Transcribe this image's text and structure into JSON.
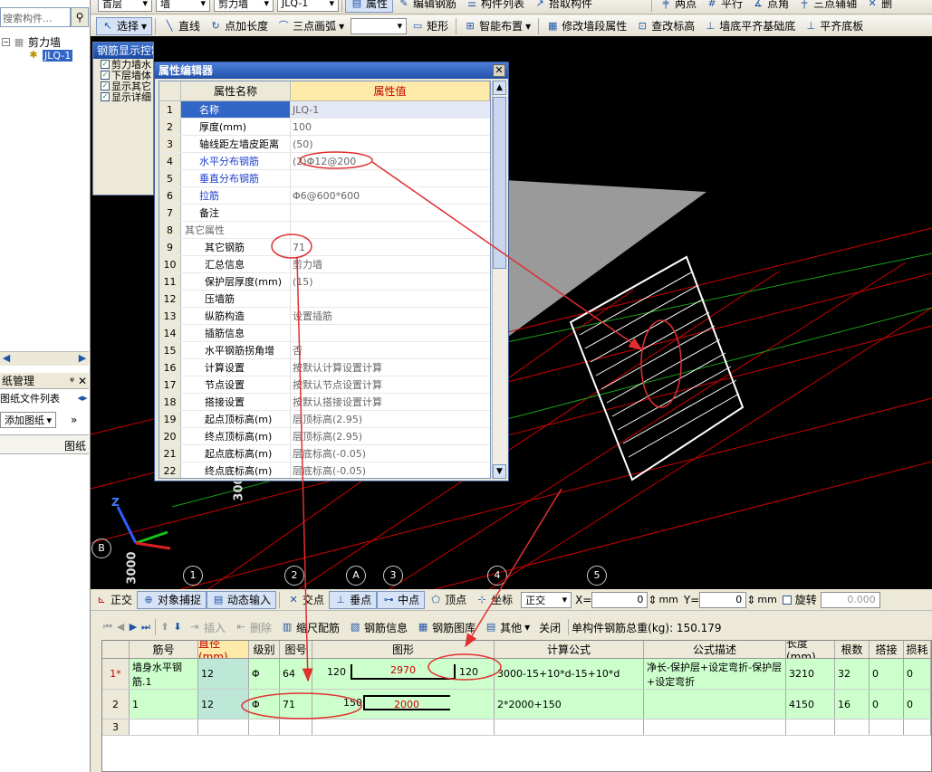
{
  "toolbar_top": {
    "floor_dropdown": "首层",
    "category_dropdown": "墙",
    "type_dropdown": "剪力墙",
    "element_dropdown": "JLQ-1",
    "attribute_btn": "属性",
    "edit_rebar_btn": "编辑钢筋",
    "component_list_btn": "构件列表",
    "pick_component_btn": "拾取构件",
    "two_point_btn": "两点",
    "parallel_btn": "平行",
    "point_angle_btn": "点角",
    "three_point_aux_btn": "三点辅轴",
    "delete_aux_btn": "删"
  },
  "toolbar_draw": {
    "select_btn": "选择",
    "line_btn": "直线",
    "point_length_btn": "点加长度",
    "three_point_arc_btn": "三点画弧",
    "rect_btn": "矩形",
    "smart_layout_btn": "智能布置",
    "modify_wall_attr_btn": "修改墙段属性",
    "check_elev_btn": "查改标高",
    "wall_bottom_align_btn": "墙底平齐基础底",
    "align_bottom_btn": "平齐底板"
  },
  "left_panel": {
    "search_placeholder": "搜索构件...",
    "tree_root": "剪力墙",
    "tree_child": "JLQ-1",
    "drawing_mgmt": "纸管理",
    "drawing_file_list": "图纸文件列表",
    "add_drawing": "添加图纸",
    "drawing_col": "图纸"
  },
  "control_panel": {
    "title": "钢筋显示控制面板",
    "items": [
      "剪力墙水",
      "下层墙体",
      "显示其它",
      "显示详细"
    ]
  },
  "property_editor": {
    "title": "属性编辑器",
    "col_name": "属性名称",
    "col_value": "属性值",
    "rows": [
      {
        "n": "1",
        "k": "名称",
        "v": "JLQ-1"
      },
      {
        "n": "2",
        "k": "厚度(mm)",
        "v": "100"
      },
      {
        "n": "3",
        "k": "轴线距左墙皮距离",
        "v": "(50)"
      },
      {
        "n": "4",
        "k": "水平分布钢筋",
        "v": "(2)Φ12@200"
      },
      {
        "n": "5",
        "k": "垂直分布钢筋",
        "v": ""
      },
      {
        "n": "6",
        "k": "拉筋",
        "v": "Φ6@600*600"
      },
      {
        "n": "7",
        "k": "备注",
        "v": ""
      },
      {
        "n": "8",
        "k": "其它属性",
        "v": ""
      },
      {
        "n": "9",
        "k": "其它钢筋",
        "v": "71"
      },
      {
        "n": "10",
        "k": "汇总信息",
        "v": "剪力墙"
      },
      {
        "n": "11",
        "k": "保护层厚度(mm)",
        "v": "(15)"
      },
      {
        "n": "12",
        "k": "压墙筋",
        "v": ""
      },
      {
        "n": "13",
        "k": "纵筋构造",
        "v": "设置插筋"
      },
      {
        "n": "14",
        "k": "插筋信息",
        "v": ""
      },
      {
        "n": "15",
        "k": "水平钢筋拐角增",
        "v": "否"
      },
      {
        "n": "16",
        "k": "计算设置",
        "v": "按默认计算设置计算"
      },
      {
        "n": "17",
        "k": "节点设置",
        "v": "按默认节点设置计算"
      },
      {
        "n": "18",
        "k": "搭接设置",
        "v": "按默认搭接设置计算"
      },
      {
        "n": "19",
        "k": "起点顶标高(m)",
        "v": "层顶标高(2.95)"
      },
      {
        "n": "20",
        "k": "终点顶标高(m)",
        "v": "层顶标高(2.95)"
      },
      {
        "n": "21",
        "k": "起点底标高(m)",
        "v": "层底标高(-0.05)"
      },
      {
        "n": "22",
        "k": "终点底标高(m)",
        "v": "层底标高(-0.05)"
      }
    ]
  },
  "canvas": {
    "axis_labels": [
      "1",
      "2",
      "A",
      "3",
      "4",
      "5",
      "B"
    ],
    "dim_label": "3000",
    "axis_z": "Z"
  },
  "snap_toolbar": {
    "ortho_btn": "正交",
    "object_snap_btn": "对象捕捉",
    "dynamic_input_btn": "动态输入",
    "intersect_btn": "交点",
    "perp_btn": "垂点",
    "mid_btn": "中点",
    "vertex_btn": "顶点",
    "coord_btn": "坐标",
    "mode_dropdown": "正交",
    "x_label": "X=",
    "x_value": "0",
    "y_label": "Y=",
    "y_value": "0",
    "unit_mm": "mm",
    "rotate_label": "旋转",
    "rotate_value": "0.000"
  },
  "rebar_toolbar": {
    "insert_btn": "插入",
    "delete_btn": "删除",
    "scale_btn": "缩尺配筋",
    "rebar_info_btn": "钢筋信息",
    "rebar_lib_btn": "钢筋图库",
    "other_btn": "其他",
    "close_btn": "关闭",
    "total_weight": "单构件钢筋总重(kg): 150.179"
  },
  "rebar_grid": {
    "headers": [
      "筋号",
      "直径(mm)",
      "级别",
      "图号",
      "图形",
      "计算公式",
      "公式描述",
      "长度(mm)",
      "根数",
      "搭接",
      "损耗"
    ],
    "rows": [
      {
        "idx": "1*",
        "name": "墙身水平钢筋.1",
        "dia": "12",
        "grade": "Φ",
        "fig": "64",
        "shape_left": "120",
        "shape_mid": "2970",
        "shape_right": "120",
        "formula": "3000-15+10*d-15+10*d",
        "desc": "净长-保护层+设定弯折-保护层+设定弯折",
        "len": "3210",
        "count": "32",
        "lap": "0",
        "loss": "0"
      },
      {
        "idx": "2",
        "name": "1",
        "dia": "12",
        "grade": "Φ",
        "fig": "71",
        "shape_left": "150",
        "shape_mid": "2000",
        "shape_right": "",
        "formula": "2*2000+150",
        "desc": "",
        "len": "4150",
        "count": "16",
        "lap": "0",
        "loss": "0"
      },
      {
        "idx": "3",
        "name": "",
        "dia": "",
        "grade": "",
        "fig": "",
        "shape_left": "",
        "shape_mid": "",
        "shape_right": "",
        "formula": "",
        "desc": "",
        "len": "",
        "count": "",
        "lap": "",
        "loss": ""
      }
    ]
  },
  "colors": {
    "accent": "#3166c6",
    "annotation": "#e03030",
    "grid_green": "#ccffcc"
  }
}
